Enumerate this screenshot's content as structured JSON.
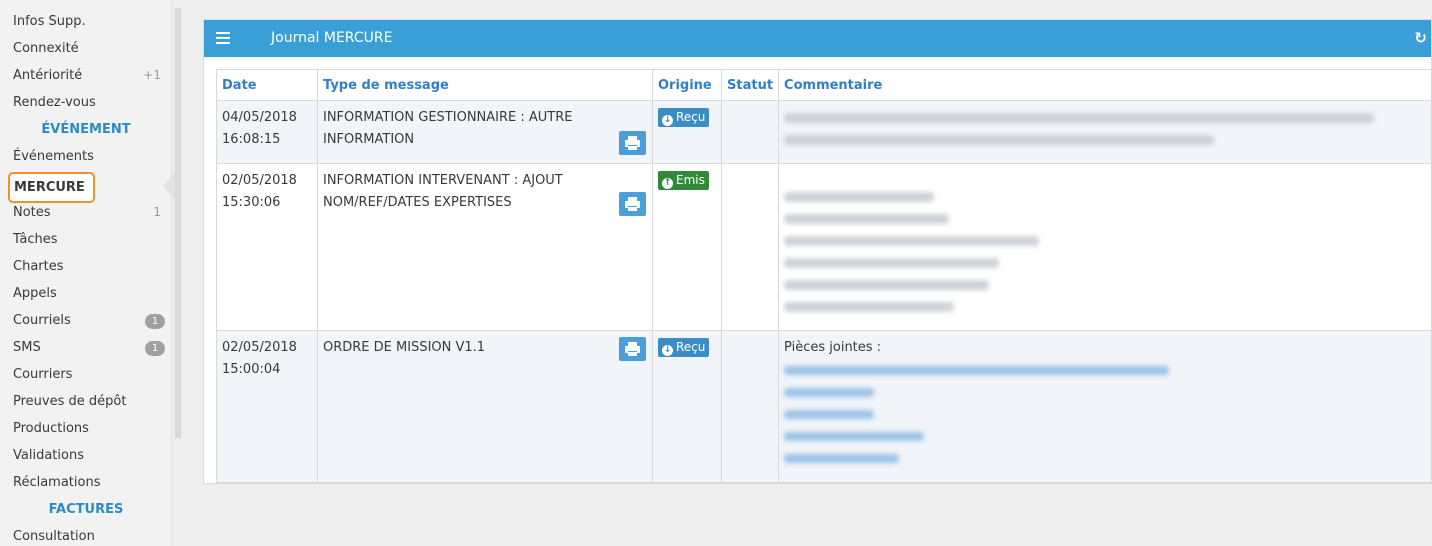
{
  "sidebar": {
    "items": [
      {
        "label": "Infos Supp."
      },
      {
        "label": "Connexité"
      },
      {
        "label": "Antériorité",
        "count": "+1"
      },
      {
        "label": "Rendez-vous"
      }
    ],
    "section_event": "ÉVÉNEMENT",
    "event_items": [
      {
        "label": "Événements"
      },
      {
        "label": "MERCURE",
        "active": true
      },
      {
        "label": "Notes",
        "count": "1"
      },
      {
        "label": "Tâches"
      },
      {
        "label": "Chartes"
      },
      {
        "label": "Appels"
      },
      {
        "label": "Courriels",
        "badge": "1"
      },
      {
        "label": "SMS",
        "badge": "1"
      },
      {
        "label": "Courriers"
      },
      {
        "label": "Preuves de dépôt"
      },
      {
        "label": "Productions"
      },
      {
        "label": "Validations"
      },
      {
        "label": "Réclamations"
      }
    ],
    "section_invoices": "FACTURES",
    "invoice_items": [
      {
        "label": "Consultation"
      }
    ]
  },
  "widget": {
    "title": "Journal MERCURE",
    "menu_icon": "hamburger-icon",
    "refresh_icon": "refresh-icon"
  },
  "table": {
    "columns": [
      "Date",
      "Type de message",
      "Origine",
      "Statut",
      "Commentaire"
    ],
    "rows": [
      {
        "date": "04/05/2018",
        "time": "16:08:15",
        "type_line1": "INFORMATION GESTIONNAIRE : AUTRE",
        "type_line2": "INFORMATION",
        "origin": "Reçu",
        "origin_icon": "arrow-down-circle-icon",
        "status": "",
        "comment_title": ""
      },
      {
        "date": "02/05/2018",
        "time": "15:30:06",
        "type_line1": "INFORMATION INTERVENANT : AJOUT",
        "type_line2": "NOM/REF/DATES EXPERTISES",
        "origin": "Emis",
        "origin_icon": "arrow-up-circle-icon",
        "status": "",
        "comment_title": ""
      },
      {
        "date": "02/05/2018",
        "time": "15:00:04",
        "type_line1": "ORDRE DE MISSION V1.1",
        "type_line2": "",
        "origin": "Reçu",
        "origin_icon": "arrow-down-circle-icon",
        "status": "",
        "comment_title": "Pièces jointes :"
      }
    ]
  },
  "colors": {
    "accent": "#3a9fd6",
    "header_text": "#307ecc",
    "active_outline": "#f0902e",
    "received_tag": "#3a8dc5",
    "emitted_tag": "#2f8a3a"
  }
}
